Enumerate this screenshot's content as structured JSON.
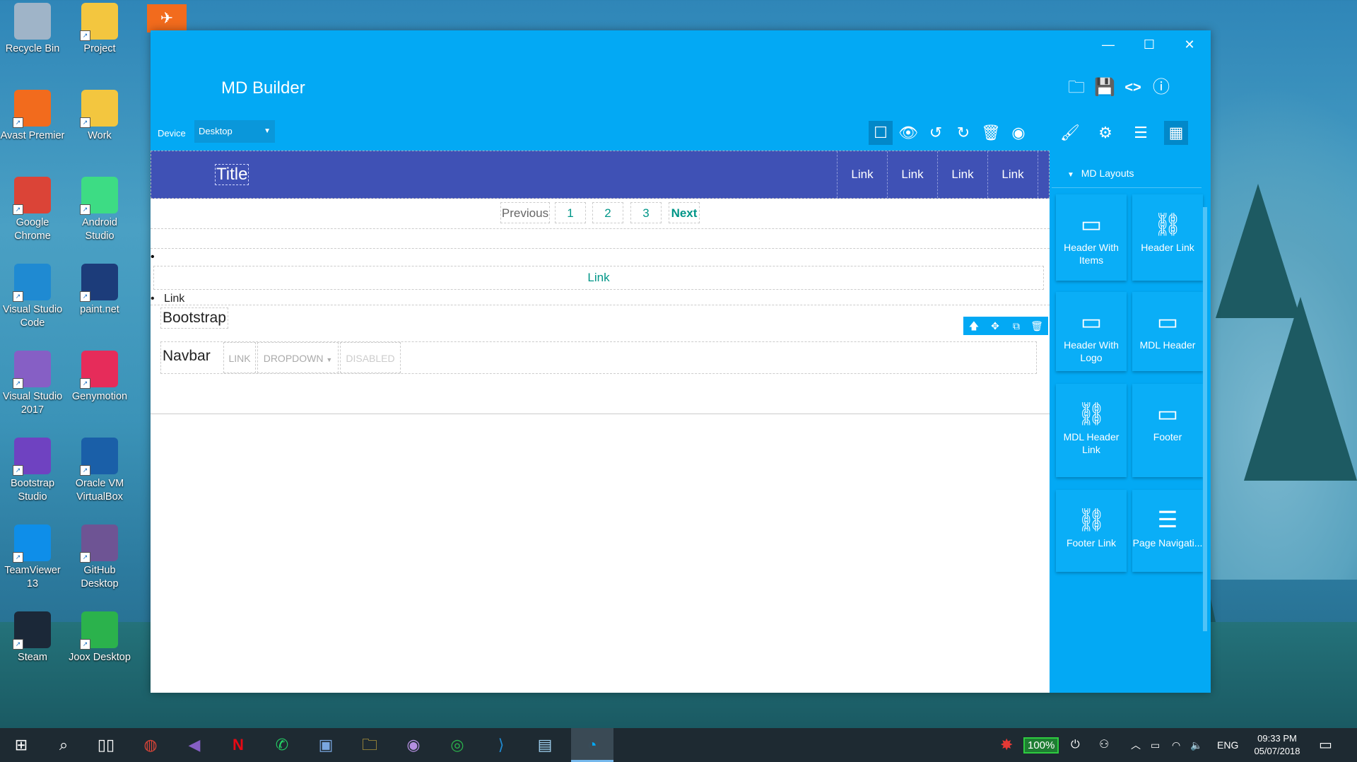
{
  "desktop": {
    "icons": [
      {
        "label": "Recycle Bin",
        "icon": "recycle-bin-icon",
        "color": "#9fb4c8"
      },
      {
        "label": "Project",
        "icon": "folder-icon",
        "color": "#f3c63f"
      },
      {
        "label": "Avast Premier",
        "icon": "avast-icon",
        "color": "#f26b1d"
      },
      {
        "label": "Work",
        "icon": "folder-clock-icon",
        "color": "#f3c63f"
      },
      {
        "label": "Google Chrome",
        "icon": "chrome-icon",
        "color": "#db4437"
      },
      {
        "label": "Android Studio",
        "icon": "android-studio-icon",
        "color": "#3ddc84"
      },
      {
        "label": "Visual Studio Code",
        "icon": "vscode-icon",
        "color": "#1f8ad2"
      },
      {
        "label": "paint.net",
        "icon": "paintnet-icon",
        "color": "#1c3c7a"
      },
      {
        "label": "Visual Studio 2017",
        "icon": "visual-studio-icon",
        "color": "#865fc5"
      },
      {
        "label": "Genymotion",
        "icon": "genymotion-icon",
        "color": "#e62c5a"
      },
      {
        "label": "Bootstrap Studio",
        "icon": "bootstrap-studio-icon",
        "color": "#6f42c1"
      },
      {
        "label": "Oracle VM VirtualBox",
        "icon": "virtualbox-icon",
        "color": "#1a5fa8"
      },
      {
        "label": "TeamViewer 13",
        "icon": "teamviewer-icon",
        "color": "#0e8ee9"
      },
      {
        "label": "GitHub Desktop",
        "icon": "github-desktop-icon",
        "color": "#6e5494"
      },
      {
        "label": "Steam",
        "icon": "steam-icon",
        "color": "#1b2838"
      },
      {
        "label": "Joox Desktop",
        "icon": "joox-icon",
        "color": "#2bb24c"
      }
    ]
  },
  "app": {
    "title": "MD Builder",
    "accent": "#03a9f4",
    "window_buttons": {
      "minimize": "—",
      "maximize": "☐",
      "close": "✕"
    },
    "header_icons": [
      "open-folder-icon",
      "save-icon",
      "code-icon",
      "info-icon"
    ],
    "toolbar": {
      "device_label": "Device",
      "device_value": "Desktop",
      "tools": [
        "select-box-icon",
        "preview-eye-icon",
        "undo-icon",
        "redo-icon",
        "delete-icon",
        "github-icon"
      ],
      "panel_tabs": [
        "brush-icon",
        "settings-gear-icon",
        "menu-list-icon",
        "grid-layout-icon"
      ]
    },
    "canvas": {
      "header": {
        "title": "Title",
        "links": [
          "Link",
          "Link",
          "Link",
          "Link"
        ],
        "color": "#3f51b5"
      },
      "pagination": {
        "previous": "Previous",
        "pages": [
          "1",
          "2",
          "3"
        ],
        "next": "Next"
      },
      "list_link": "Link",
      "list_item": "Link",
      "bootstrap_label": "Bootstrap",
      "navbar": {
        "brand": "Navbar",
        "link": "LINK",
        "dropdown": "DROPDOWN",
        "disabled": "DISABLED"
      }
    },
    "panel": {
      "section_title": "MD Layouts",
      "items": [
        {
          "label": "Header With Items",
          "icon": "header-bar-icon"
        },
        {
          "label": "Header Link",
          "icon": "link-chain-icon"
        },
        {
          "label": "Header With Logo",
          "icon": "header-bar-icon"
        },
        {
          "label": "MDL Header",
          "icon": "header-bar-icon"
        },
        {
          "label": "MDL Header Link",
          "icon": "link-chain-icon"
        },
        {
          "label": "Footer",
          "icon": "footer-bar-icon"
        },
        {
          "label": "Footer Link",
          "icon": "link-chain-icon"
        },
        {
          "label": "Page Navigati...",
          "icon": "numbered-list-icon"
        }
      ]
    }
  },
  "taskbar": {
    "apps": [
      "windows-start-icon",
      "search-icon",
      "task-view-icon",
      "chrome-icon",
      "visual-studio-icon",
      "netflix-icon",
      "whatsapp-icon",
      "paintnet-icon",
      "file-explorer-icon",
      "github-desktop-icon",
      "joox-icon",
      "vscode-icon",
      "notepad-icon",
      "md-builder-icon"
    ],
    "battery": "100%",
    "language": "ENG",
    "time": "09:33 PM",
    "date": "05/07/2018"
  }
}
